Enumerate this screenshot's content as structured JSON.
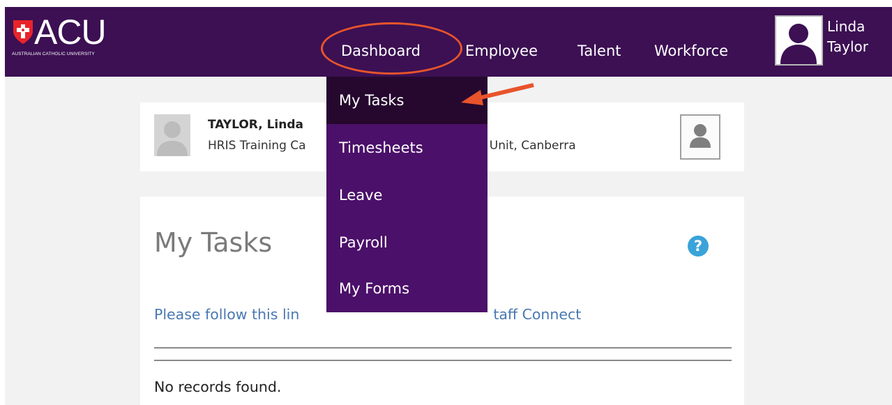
{
  "logo": {
    "wordmark": "ACU",
    "subtitle": "AUSTRALIAN CATHOLIC UNIVERSITY"
  },
  "nav": {
    "dashboard": "Dashboard",
    "employee": "Employee",
    "talent": "Talent",
    "workforce": "Workforce"
  },
  "user": {
    "first_name": "Linda",
    "last_name": "Taylor"
  },
  "dropdown": {
    "items": [
      "My Tasks",
      "Timesheets",
      "Leave",
      "Payroll",
      "My Forms"
    ]
  },
  "profile": {
    "name": "TAYLOR, Linda",
    "department": "HRIS Training Ca",
    "department_tail": "ent NS Unit, Canberra"
  },
  "tasks": {
    "title": "My Tasks",
    "help_label": "?",
    "link_prefix": "Please follow this lin",
    "link_tail": "taff Connect",
    "no_records": "No records found."
  },
  "colors": {
    "brand_purple": "#3c1053",
    "dropdown_purple": "#4b1069",
    "active_item": "#26082f",
    "highlight": "#e8542b",
    "link_blue": "#4a78b2",
    "help_blue": "#3aa3d9"
  },
  "icons": {
    "logo_shield": "shield-cross-icon",
    "user": "user-silhouette-icon",
    "help": "question-circle-icon",
    "annotation": "arrow-left-icon"
  }
}
